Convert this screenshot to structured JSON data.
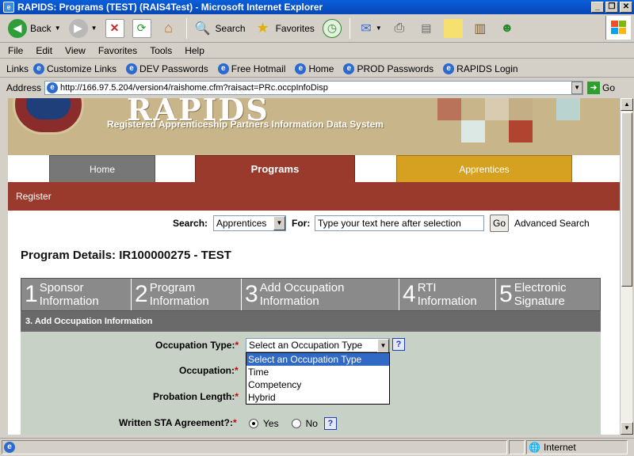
{
  "window": {
    "title": "RAPIDS: Programs  (TEST) (RAIS4Test) - Microsoft Internet Explorer"
  },
  "toolbar": {
    "back_label": "Back",
    "search_label": "Search",
    "favorites_label": "Favorites"
  },
  "menu": [
    "File",
    "Edit",
    "View",
    "Favorites",
    "Tools",
    "Help"
  ],
  "links": {
    "label": "Links",
    "items": [
      "Customize Links",
      "DEV Passwords",
      "Free Hotmail",
      "Home",
      "PROD Passwords",
      "RAPIDS Login"
    ]
  },
  "address": {
    "label": "Address",
    "url": "http://166.97.5.204/version4/raishome.cfm?raisact=PRc.occpInfoDisp",
    "go_label": "Go"
  },
  "banner": {
    "logo_text": "RAPIDS",
    "subtitle": "Registered Apprenticeship Partners Information Data System"
  },
  "nav": {
    "home": "Home",
    "programs": "Programs",
    "apprentices": "Apprentices",
    "subnav": "Register"
  },
  "search": {
    "label": "Search:",
    "selected": "Apprentices",
    "for_label": "For:",
    "input_value": "Type your text here after selection",
    "go": "Go",
    "advanced": "Advanced Search"
  },
  "page_title": "Program Details: IR100000275 - TEST",
  "steps": [
    {
      "num": "1",
      "line1": "Sponsor",
      "line2": "Information"
    },
    {
      "num": "2",
      "line1": "Program",
      "line2": "Information"
    },
    {
      "num": "3",
      "line1": "Add Occupation",
      "line2": "Information"
    },
    {
      "num": "4",
      "line1": "RTI",
      "line2": "Information"
    },
    {
      "num": "5",
      "line1": "Electronic",
      "line2": "Signature"
    }
  ],
  "section_header": "3.   Add Occupation Information",
  "form": {
    "occupation_type_label": "Occupation Type:",
    "occupation_label": "Occupation:",
    "probation_label": "Probation Length:",
    "sta_label": "Written STA Agreement?:",
    "required_mark": "*",
    "occupation_type_selected": "Select an Occupation Type",
    "occupation_type_options": [
      "Select an Occupation Type",
      "Time",
      "Competency",
      "Hybrid"
    ],
    "yes": "Yes",
    "no": "No",
    "help": "?"
  },
  "status": {
    "zone": "Internet"
  }
}
